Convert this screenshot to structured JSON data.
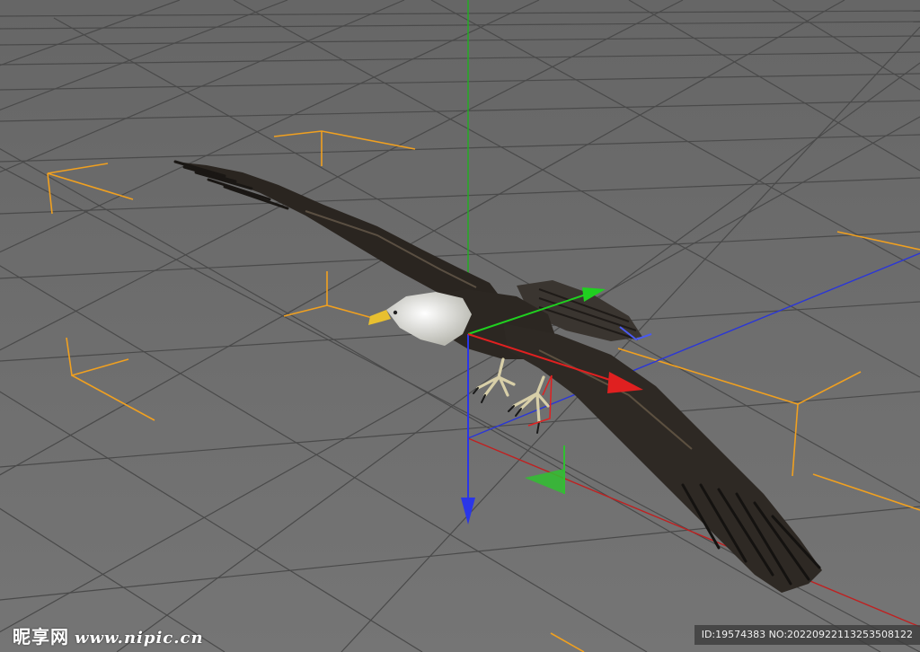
{
  "viewport": {
    "background": "#6e6e6e",
    "grid_color": "#4a4a4a",
    "selection_bracket_color": "#f0a020",
    "axis_colors": {
      "x": "#e02020",
      "y": "#20c020",
      "z": "#2030e0"
    },
    "object": "eagle-model"
  },
  "watermark": {
    "logo_text": "昵享网",
    "site": "www.nipic.cn",
    "id_text": "ID:19574383 NO:20220922113253508122"
  }
}
